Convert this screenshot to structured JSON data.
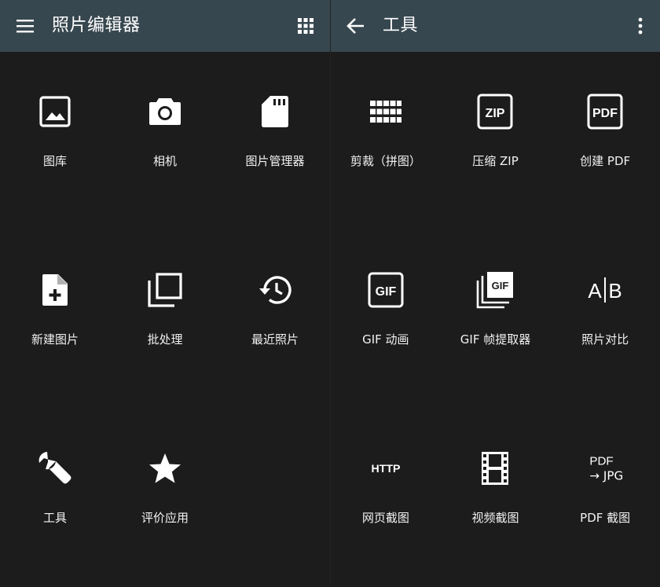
{
  "left": {
    "title": "照片编辑器",
    "tiles": [
      {
        "label": "图库",
        "icon": "image-icon"
      },
      {
        "label": "相机",
        "icon": "camera-icon"
      },
      {
        "label": "图片管理器",
        "icon": "sd-card-icon"
      },
      {
        "label": "新建图片",
        "icon": "new-file-icon"
      },
      {
        "label": "批处理",
        "icon": "batch-icon"
      },
      {
        "label": "最近照片",
        "icon": "history-icon"
      },
      {
        "label": "工具",
        "icon": "wrench-icon"
      },
      {
        "label": "评价应用",
        "icon": "star-icon"
      }
    ]
  },
  "right": {
    "title": "工具",
    "tiles": [
      {
        "label": "剪裁（拼图）",
        "icon": "grid-icon"
      },
      {
        "label": "压缩 ZIP",
        "icon": "zip-icon",
        "icon_text": "ZIP"
      },
      {
        "label": "创建 PDF",
        "icon": "pdf-icon",
        "icon_text": "PDF"
      },
      {
        "label": "GIF 动画",
        "icon": "gif-icon",
        "icon_text": "GIF"
      },
      {
        "label": "GIF 帧提取器",
        "icon": "gif-frames-icon",
        "icon_text": "GIF"
      },
      {
        "label": "照片对比",
        "icon": "compare-icon",
        "icon_text_a": "A",
        "icon_text_b": "B"
      },
      {
        "label": "网页截图",
        "icon": "http-icon",
        "icon_text": "HTTP"
      },
      {
        "label": "视频截图",
        "icon": "film-icon"
      },
      {
        "label": "PDF 截图",
        "icon": "pdf-to-jpg-icon",
        "icon_text_top": "PDF",
        "icon_text_bottom": "→ JPG"
      }
    ]
  }
}
